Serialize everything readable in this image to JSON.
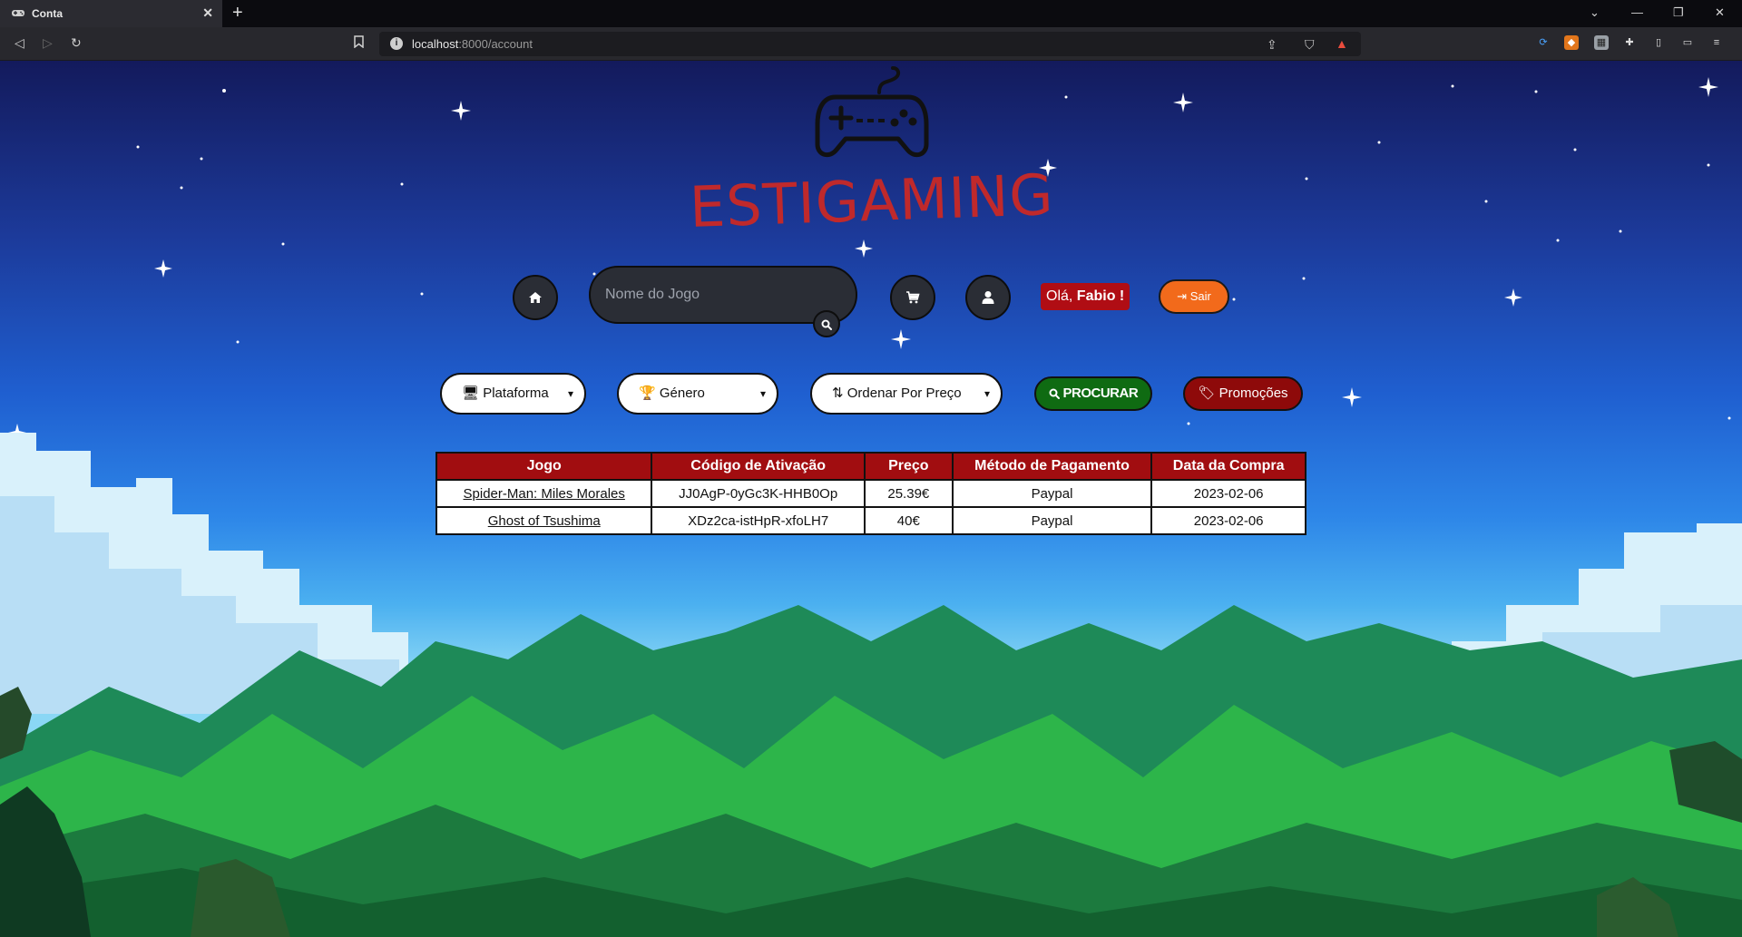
{
  "browser": {
    "tab_title": "Conta",
    "new_tab": "+",
    "url_host": "localhost",
    "url_rest": ":8000/account"
  },
  "brand": {
    "name": "ESTIGAMING"
  },
  "nav": {
    "search_placeholder": "Nome do Jogo",
    "greeting_prefix": "Olá, ",
    "greeting_name": "Fabio !",
    "logout_label": "Sair"
  },
  "filters": {
    "platform_label": "Plataforma",
    "genre_label": "Género",
    "sort_label": "Ordenar Por Preço",
    "search_button": "PROCURAR",
    "promotions_button": "Promoções"
  },
  "orders": {
    "headers": [
      "Jogo",
      "Código de Ativação",
      "Preço",
      "Método de Pagamento",
      "Data da Compra"
    ],
    "rows": [
      {
        "game": "Spider-Man: Miles Morales",
        "code": "JJ0AgP-0yGc3K-HHB0Op",
        "price": "25.39€",
        "payment": "Paypal",
        "date": "2023-02-06"
      },
      {
        "game": "Ghost of Tsushima",
        "code": "XDz2ca-istHpR-xfoLH7",
        "price": "40€",
        "payment": "Paypal",
        "date": "2023-02-06"
      }
    ]
  },
  "colors": {
    "brand_red": "#c0292b",
    "table_header": "#a10d10",
    "search_green": "#0f6b12",
    "promo_red": "#8e0a0a",
    "logout_orange": "#f26a1b"
  }
}
